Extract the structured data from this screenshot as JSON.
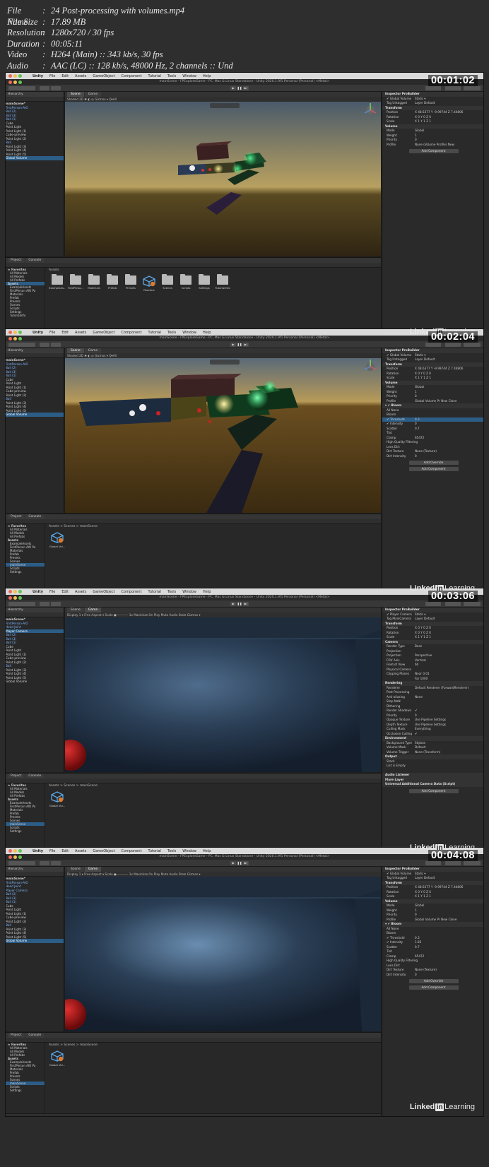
{
  "info": {
    "rows": [
      {
        "key": "File Name",
        "value": "24 Post-processing with volumes.mp4"
      },
      {
        "key": "File Size",
        "value": "17.89 MB"
      },
      {
        "key": "Resolution",
        "value": "1280x720 / 30 fps"
      },
      {
        "key": "Duration",
        "value": "00:05:11"
      },
      {
        "key": "Video",
        "value": "H264 (Main) :: 343 kb/s, 30 fps"
      },
      {
        "key": "Audio",
        "value": "AAC (LC) :: 128 kb/s, 48000 Hz, 2 channels :: Und"
      }
    ],
    "separator": ":"
  },
  "menu": [
    "Unity",
    "File",
    "Edit",
    "Assets",
    "GameObject",
    "Component",
    "Tutorial",
    "Tools",
    "Window",
    "Help"
  ],
  "window_title": "mainScene - FPExploreGame - PC, Mac & Linux Standalone - Unity 2020.1.9f1 Personal (Personal) <Metal>",
  "watermark": {
    "brand": "Linked",
    "in": "in",
    "rest": " Learning"
  },
  "colors": {
    "selection": "#2c5d87",
    "blue_object": "#7fb6ff",
    "green_glow": "#2dd36f",
    "yellow_glow": "#f5d76e"
  },
  "frames": [
    {
      "timestamp": "00:01:02",
      "view": "scene",
      "vp_tabs": [
        "Scene",
        "Game"
      ],
      "vp_bar": "Shaded   2D   ✱   ◐   ◎   Gizmos  ▾   Q▾All",
      "hierarchy": [
        {
          "t": "mainScene*",
          "c": "bold"
        },
        {
          "t": "  FirstPerson-AIO",
          "c": "blue"
        },
        {
          "t": "  Ball (2)",
          "c": "blue"
        },
        {
          "t": "  Ball (3)",
          "c": "blue"
        },
        {
          "t": "  Ball (1)",
          "c": "blue"
        },
        {
          "t": "  Cube",
          "c": ""
        },
        {
          "t": "  Point Light",
          "c": ""
        },
        {
          "t": "  Point Light (1)",
          "c": ""
        },
        {
          "t": "  Cube-preview",
          "c": ""
        },
        {
          "t": "  Point Light (2)",
          "c": ""
        },
        {
          "t": "  Ball",
          "c": "blue"
        },
        {
          "t": "  Point Light (3)",
          "c": ""
        },
        {
          "t": "  Point Light (4)",
          "c": ""
        },
        {
          "t": "  Point Light (5)",
          "c": ""
        },
        {
          "t": "  Global Volume",
          "c": "sel"
        }
      ],
      "inspector": [
        {
          "t": "Inspector    ProBuilder",
          "c": "head"
        },
        {
          "t": "✔ Global Volume",
          "v": "Static ▾"
        },
        {
          "t": "Tag  Untagged",
          "v": "Layer  Default"
        },
        {
          "t": "Transform",
          "c": "head"
        },
        {
          "t": "Position",
          "v": "X 48.6377  Y -9.99744  Z 7.44806"
        },
        {
          "t": "Rotation",
          "v": "X 0   Y 0   Z 0"
        },
        {
          "t": "Scale",
          "v": "X 1   Y 1   Z 1"
        },
        {
          "t": "Volume",
          "c": "head"
        },
        {
          "t": "Mode",
          "v": "Global"
        },
        {
          "t": "Weight",
          "v": "1"
        },
        {
          "t": "Priority",
          "v": "0"
        },
        {
          "t": "Profile",
          "v": "None (Volume Profile)   New"
        },
        {
          "t": "",
          "btn": "Add Component"
        }
      ],
      "project_tabs": [
        "Project",
        "Console"
      ],
      "project_left": [
        {
          "t": "★ Favorites",
          "c": "head"
        },
        {
          "t": "All Materials",
          "c": ""
        },
        {
          "t": "All Models",
          "c": ""
        },
        {
          "t": "All Prefabs",
          "c": ""
        },
        {
          "t": "Assets",
          "c": "head sel"
        },
        {
          "t": "ExampleAssets",
          "c": ""
        },
        {
          "t": "FirstPerson AIO Pa",
          "c": ""
        },
        {
          "t": "Materials",
          "c": ""
        },
        {
          "t": "Prefab",
          "c": ""
        },
        {
          "t": "Presets",
          "c": ""
        },
        {
          "t": "Scenes",
          "c": ""
        },
        {
          "t": "Scripts",
          "c": ""
        },
        {
          "t": "Settings",
          "c": ""
        },
        {
          "t": "TutorialInfo",
          "c": ""
        }
      ],
      "breadcrumb": "Assets",
      "assets": [
        "ExampleAs...",
        "FirstPerso...",
        "Materials",
        "Prefab",
        "Presets",
        "Readme",
        "Scenes",
        "Scripts",
        "Settings",
        "TutorialInfo"
      ]
    },
    {
      "timestamp": "00:02:04",
      "view": "scene",
      "vp_tabs": [
        "Scene",
        "Game"
      ],
      "vp_bar": "Shaded   2D   ✱   ◐   ◎   Gizmos  ▾   Q▾All",
      "hierarchy": [
        {
          "t": "mainScene*",
          "c": "bold"
        },
        {
          "t": "  FirstPerson-AIO",
          "c": "blue"
        },
        {
          "t": "  Ball (2)",
          "c": "blue"
        },
        {
          "t": "  Ball (3)",
          "c": "blue"
        },
        {
          "t": "  Ball (1)",
          "c": "blue"
        },
        {
          "t": "  Cube",
          "c": ""
        },
        {
          "t": "  Point Light",
          "c": ""
        },
        {
          "t": "  Point Light (1)",
          "c": ""
        },
        {
          "t": "  Cube-preview",
          "c": ""
        },
        {
          "t": "  Point Light (2)",
          "c": ""
        },
        {
          "t": "  Ball",
          "c": "blue"
        },
        {
          "t": "  Point Light (3)",
          "c": ""
        },
        {
          "t": "  Point Light (4)",
          "c": ""
        },
        {
          "t": "  Point Light (5)",
          "c": ""
        },
        {
          "t": "  Global Volume",
          "c": "sel"
        }
      ],
      "inspector": [
        {
          "t": "Inspector    ProBuilder",
          "c": "head"
        },
        {
          "t": "✔ Global Volume",
          "v": "Static ▾"
        },
        {
          "t": "Tag  Untagged",
          "v": "Layer  Default"
        },
        {
          "t": "Transform",
          "c": "head"
        },
        {
          "t": "Position",
          "v": "X 48.6377  Y -9.99744  Z 7.44806"
        },
        {
          "t": "Rotation",
          "v": "X 0   Y 0   Z 0"
        },
        {
          "t": "Scale",
          "v": "X 1   Y 1   Z 1"
        },
        {
          "t": "Volume",
          "c": "head"
        },
        {
          "t": "Mode",
          "v": "Global"
        },
        {
          "t": "Weight",
          "v": "1"
        },
        {
          "t": "Priority",
          "v": "0"
        },
        {
          "t": "Profile",
          "v": "Global Volume Pr   New  Clone"
        },
        {
          "t": "▾ ✔ Bloom",
          "c": "head"
        },
        {
          "t": "All   None",
          "v": ""
        },
        {
          "t": "Bloom",
          "v": ""
        },
        {
          "t": "✔ Threshold",
          "v": "0.3",
          "c": "sel"
        },
        {
          "t": "✔ Intensity",
          "v": "0"
        },
        {
          "t": "Scatter",
          "v": "0.7"
        },
        {
          "t": "Tint",
          "v": ""
        },
        {
          "t": "Clamp",
          "v": "65472"
        },
        {
          "t": "High Quality Filtering",
          "v": ""
        },
        {
          "t": "Lens Dirt",
          "v": ""
        },
        {
          "t": "Dirt Texture",
          "v": "None (Texture)"
        },
        {
          "t": "Dirt Intensity",
          "v": "0"
        },
        {
          "t": "",
          "btn": "Add Override"
        },
        {
          "t": "",
          "btn": "Add Component"
        }
      ],
      "project_tabs": [
        "Project",
        "Console"
      ],
      "project_left": [
        {
          "t": "★ Favorites",
          "c": "head"
        },
        {
          "t": "All Materials",
          "c": ""
        },
        {
          "t": "All Models",
          "c": ""
        },
        {
          "t": "All Prefabs",
          "c": ""
        },
        {
          "t": "Assets",
          "c": "head"
        },
        {
          "t": "ExampleAssets",
          "c": ""
        },
        {
          "t": "FirstPerson AIO Pa",
          "c": ""
        },
        {
          "t": "Materials",
          "c": ""
        },
        {
          "t": "Prefab",
          "c": ""
        },
        {
          "t": "Presets",
          "c": ""
        },
        {
          "t": "Scenes",
          "c": ""
        },
        {
          "t": "mainScene",
          "c": "sel"
        },
        {
          "t": "Scripts",
          "c": ""
        },
        {
          "t": "Settings",
          "c": ""
        }
      ],
      "breadcrumb": "Assets > Scenes > mainScene",
      "assets": [
        "Global Vol..."
      ]
    },
    {
      "timestamp": "00:03:06",
      "view": "game",
      "vp_tabs": [
        "Scene",
        "Game"
      ],
      "vp_bar": "Display 1  ▾    Free Aspect  ▾     Scale ●————  1x                                              Maximize On Play   Mute Audio   Stats   Gizmos ▾",
      "hierarchy": [
        {
          "t": "mainScene*",
          "c": "bold"
        },
        {
          "t": "  FirstPerson-AIO",
          "c": "blue"
        },
        {
          "t": "    Head Joint",
          "c": "blue"
        },
        {
          "t": "      Player Camera",
          "c": "sel"
        },
        {
          "t": "  Ball (2)",
          "c": "blue"
        },
        {
          "t": "  Ball (3)",
          "c": "blue"
        },
        {
          "t": "  Ball (1)",
          "c": "blue"
        },
        {
          "t": "  Cube",
          "c": ""
        },
        {
          "t": "  Point Light",
          "c": ""
        },
        {
          "t": "  Point Light (1)",
          "c": ""
        },
        {
          "t": "  Cube-preview",
          "c": ""
        },
        {
          "t": "  Point Light (2)",
          "c": ""
        },
        {
          "t": "  Ball",
          "c": "blue"
        },
        {
          "t": "  Point Light (3)",
          "c": ""
        },
        {
          "t": "  Point Light (4)",
          "c": ""
        },
        {
          "t": "  Point Light (5)",
          "c": ""
        },
        {
          "t": "  Global Volume",
          "c": ""
        }
      ],
      "inspector": [
        {
          "t": "Inspector    ProBuilder",
          "c": "head"
        },
        {
          "t": "✔ Player Camera",
          "v": "Static ▾"
        },
        {
          "t": "Tag  MainCamera",
          "v": "Layer  Default"
        },
        {
          "t": "Transform",
          "c": "head"
        },
        {
          "t": "Position",
          "v": "X 0   Y 0   Z 0"
        },
        {
          "t": "Rotation",
          "v": "X 0   Y 0   Z 0"
        },
        {
          "t": "Scale",
          "v": "X 1   Y 1   Z 1"
        },
        {
          "t": "Camera",
          "c": "head"
        },
        {
          "t": "Render Type",
          "v": "Base"
        },
        {
          "t": "Projection",
          "v": ""
        },
        {
          "t": "Projection",
          "v": "Perspective"
        },
        {
          "t": "FOV Axis",
          "v": "Vertical"
        },
        {
          "t": "Field of View",
          "v": "60"
        },
        {
          "t": "Physical Camera",
          "v": ""
        },
        {
          "t": "Clipping Planes",
          "v": "Near  0.01"
        },
        {
          "t": "",
          "v": "Far   1000"
        },
        {
          "t": "Rendering",
          "c": "head"
        },
        {
          "t": "Renderer",
          "v": "Default Renderer (ForwardRenderer)"
        },
        {
          "t": "Post Processing",
          "v": ""
        },
        {
          "t": "Anti-aliasing",
          "v": "None"
        },
        {
          "t": "Stop NaN",
          "v": ""
        },
        {
          "t": "Dithering",
          "v": ""
        },
        {
          "t": "Render Shadows",
          "v": "✔"
        },
        {
          "t": "Priority",
          "v": "0"
        },
        {
          "t": "Opaque Texture",
          "v": "Use Pipeline Settings"
        },
        {
          "t": "Depth Texture",
          "v": "Use Pipeline Settings"
        },
        {
          "t": "Culling Mask",
          "v": "Everything"
        },
        {
          "t": "Occlusion Culling",
          "v": "✔"
        },
        {
          "t": "Environment",
          "c": "head"
        },
        {
          "t": "Background Type",
          "v": "Skybox"
        },
        {
          "t": "Volume Mask",
          "v": "Default"
        },
        {
          "t": "Volume Trigger",
          "v": "None (Transform)"
        },
        {
          "t": "Output",
          "c": "head"
        },
        {
          "t": "Stack",
          "v": ""
        },
        {
          "t": "List is Empty",
          "v": ""
        },
        {
          "t": "",
          "v": ""
        },
        {
          "t": "Audio Listener",
          "c": "head"
        },
        {
          "t": "Flare Layer",
          "c": "head"
        },
        {
          "t": "Universal Additional Camera Data (Script)",
          "c": "head"
        },
        {
          "t": "",
          "btn": "Add Component"
        }
      ],
      "project_tabs": [
        "Project",
        "Console"
      ],
      "project_left": [
        {
          "t": "★ Favorites",
          "c": "head"
        },
        {
          "t": "All Materials",
          "c": ""
        },
        {
          "t": "All Models",
          "c": ""
        },
        {
          "t": "All Prefabs",
          "c": ""
        },
        {
          "t": "Assets",
          "c": "head"
        },
        {
          "t": "ExampleAssets",
          "c": ""
        },
        {
          "t": "FirstPerson AIO Pa",
          "c": ""
        },
        {
          "t": "Materials",
          "c": ""
        },
        {
          "t": "Prefab",
          "c": ""
        },
        {
          "t": "Presets",
          "c": ""
        },
        {
          "t": "Scenes",
          "c": ""
        },
        {
          "t": "mainScene",
          "c": "sel"
        },
        {
          "t": "Scripts",
          "c": ""
        },
        {
          "t": "Settings",
          "c": ""
        }
      ],
      "breadcrumb": "Assets > Scenes > mainScene",
      "assets": [
        "Global Vol..."
      ]
    },
    {
      "timestamp": "00:04:08",
      "view": "game",
      "vp_tabs": [
        "Scene",
        "Game"
      ],
      "vp_bar": "Display 1  ▾    Free Aspect  ▾     Scale ●————  1x                                              Maximize On Play   Mute Audio   Stats   Gizmos ▾",
      "hierarchy": [
        {
          "t": "mainScene*",
          "c": "bold"
        },
        {
          "t": "  FirstPerson-AIO",
          "c": "blue"
        },
        {
          "t": "    Head Joint",
          "c": "blue"
        },
        {
          "t": "      Player Camera",
          "c": "blue"
        },
        {
          "t": "  Ball (2)",
          "c": "blue"
        },
        {
          "t": "  Ball (3)",
          "c": "blue"
        },
        {
          "t": "  Ball (1)",
          "c": "blue"
        },
        {
          "t": "  Cube",
          "c": ""
        },
        {
          "t": "  Point Light",
          "c": ""
        },
        {
          "t": "  Point Light (1)",
          "c": ""
        },
        {
          "t": "  Cube-preview",
          "c": ""
        },
        {
          "t": "  Point Light (2)",
          "c": ""
        },
        {
          "t": "  Ball",
          "c": "blue"
        },
        {
          "t": "  Point Light (3)",
          "c": ""
        },
        {
          "t": "  Point Light (4)",
          "c": ""
        },
        {
          "t": "  Point Light (5)",
          "c": ""
        },
        {
          "t": "  Global Volume",
          "c": "sel"
        }
      ],
      "inspector": [
        {
          "t": "Inspector    ProBuilder",
          "c": "head"
        },
        {
          "t": "✔ Global Volume",
          "v": "Static ▾"
        },
        {
          "t": "Tag  Untagged",
          "v": "Layer  Default"
        },
        {
          "t": "Transform",
          "c": "head"
        },
        {
          "t": "Position",
          "v": "X 48.6377  Y -9.99744  Z 7.44806"
        },
        {
          "t": "Rotation",
          "v": "X 0   Y 0   Z 0"
        },
        {
          "t": "Scale",
          "v": "X 1   Y 1   Z 1"
        },
        {
          "t": "Volume",
          "c": "head"
        },
        {
          "t": "Mode",
          "v": "Global"
        },
        {
          "t": "Weight",
          "v": "1"
        },
        {
          "t": "Priority",
          "v": "0"
        },
        {
          "t": "Profile",
          "v": "Global Volume Pr   New  Clone"
        },
        {
          "t": "▾ ✔ Bloom",
          "c": "head"
        },
        {
          "t": "All   None",
          "v": ""
        },
        {
          "t": "Bloom",
          "v": ""
        },
        {
          "t": "✔ Threshold",
          "v": "0.3"
        },
        {
          "t": "✔ Intensity",
          "v": "1.85"
        },
        {
          "t": "Scatter",
          "v": "0.7"
        },
        {
          "t": "Tint",
          "v": ""
        },
        {
          "t": "Clamp",
          "v": "65472"
        },
        {
          "t": "High Quality Filtering",
          "v": ""
        },
        {
          "t": "Lens Dirt",
          "v": ""
        },
        {
          "t": "Dirt Texture",
          "v": "None (Texture)"
        },
        {
          "t": "Dirt Intensity",
          "v": "0"
        },
        {
          "t": "",
          "btn": "Add Override"
        },
        {
          "t": "",
          "btn": "Add Component"
        }
      ],
      "project_tabs": [
        "Project",
        "Console"
      ],
      "project_left": [
        {
          "t": "★ Favorites",
          "c": "head"
        },
        {
          "t": "All Materials",
          "c": ""
        },
        {
          "t": "All Models",
          "c": ""
        },
        {
          "t": "All Prefabs",
          "c": ""
        },
        {
          "t": "Assets",
          "c": "head"
        },
        {
          "t": "ExampleAssets",
          "c": ""
        },
        {
          "t": "FirstPerson AIO Pa",
          "c": ""
        },
        {
          "t": "Materials",
          "c": ""
        },
        {
          "t": "Prefab",
          "c": ""
        },
        {
          "t": "Presets",
          "c": ""
        },
        {
          "t": "Scenes",
          "c": ""
        },
        {
          "t": "mainScene",
          "c": "sel"
        },
        {
          "t": "Scripts",
          "c": ""
        },
        {
          "t": "Settings",
          "c": ""
        }
      ],
      "breadcrumb": "Assets > Scenes > mainScene",
      "assets": [
        "Global Vol..."
      ]
    }
  ]
}
